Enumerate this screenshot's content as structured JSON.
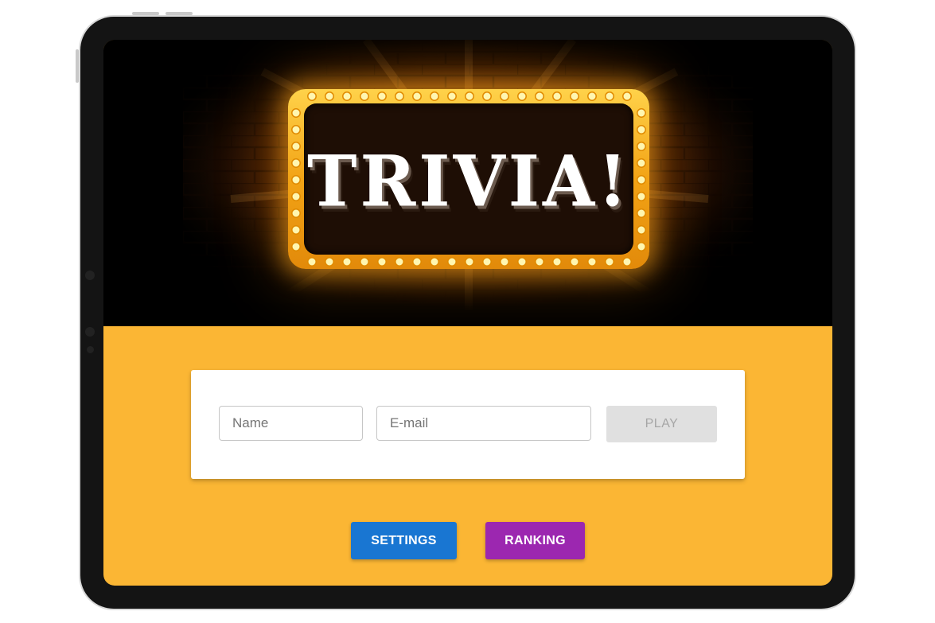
{
  "hero": {
    "logo_text": "TRIVIA!"
  },
  "form": {
    "name_placeholder": "Name",
    "email_placeholder": "E-mail",
    "play_label": "PLAY"
  },
  "actions": {
    "settings_label": "SETTINGS",
    "ranking_label": "RANKING"
  },
  "colors": {
    "background": "#fbb634",
    "settings_button": "#1976d2",
    "ranking_button": "#9c27b0",
    "play_button_disabled": "#e0e0e0",
    "marquee_gold": "#f2a315"
  }
}
